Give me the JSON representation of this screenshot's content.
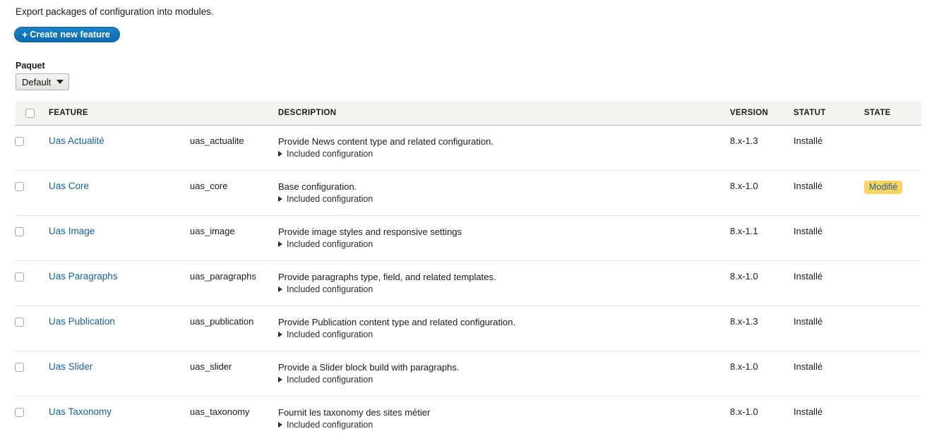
{
  "intro": {
    "text": "Export packages of configuration into modules."
  },
  "actions": {
    "create_feature": {
      "plus": "+",
      "label": "Create new feature"
    }
  },
  "filter": {
    "label": "Paquet",
    "selected": "Default",
    "options": [
      "Default"
    ],
    "caret_icon": "chevron-down-icon"
  },
  "table": {
    "select_all_name": "select-all-checkbox",
    "columns": [
      {
        "key": "check",
        "label": ""
      },
      {
        "key": "feature",
        "label": "FEATURE"
      },
      {
        "key": "machine",
        "label": ""
      },
      {
        "key": "description",
        "label": "DESCRIPTION"
      },
      {
        "key": "version",
        "label": "VERSION"
      },
      {
        "key": "statut",
        "label": "STATUT"
      },
      {
        "key": "state",
        "label": "STATE"
      }
    ],
    "details_label": "Included configuration",
    "rows": [
      {
        "feature": "Uas Actualité",
        "machine": "uas_actualite",
        "description": "Provide News content type and related configuration.",
        "details": "Included configuration",
        "version": "8.x-1.3",
        "statut": "Installé",
        "state": ""
      },
      {
        "feature": "Uas Core",
        "machine": "uas_core",
        "description": "Base configuration.",
        "details": "Included configuration",
        "version": "8.x-1.0",
        "statut": "Installé",
        "state": "Modifié"
      },
      {
        "feature": "Uas Image",
        "machine": "uas_image",
        "description": "Provide image styles and responsive settings",
        "details": "Included configuration",
        "version": "8.x-1.1",
        "statut": "Installé",
        "state": ""
      },
      {
        "feature": "Uas Paragraphs",
        "machine": "uas_paragraphs",
        "description": "Provide paragraphs type, field, and related templates.",
        "details": "Included configuration",
        "version": "8.x-1.0",
        "statut": "Installé",
        "state": ""
      },
      {
        "feature": "Uas Publication",
        "machine": "uas_publication",
        "description": "Provide Publication content type and related configuration.",
        "details": "Included configuration",
        "version": "8.x-1.3",
        "statut": "Installé",
        "state": ""
      },
      {
        "feature": "Uas Slider",
        "machine": "uas_slider",
        "description": "Provide a Slider block build with paragraphs.",
        "details": "Included configuration",
        "version": "8.x-1.0",
        "statut": "Installé",
        "state": ""
      },
      {
        "feature": "Uas Taxonomy",
        "machine": "uas_taxonomy",
        "description": "Fournit les taxonomy des sites métier",
        "details": "Included configuration",
        "version": "8.x-1.0",
        "statut": "Installé",
        "state": ""
      }
    ]
  },
  "colors": {
    "accent_button": "#0f76bc",
    "link": "#17609e",
    "badge_bg": "#fbd45c",
    "badge_text": "#1a5f9e",
    "header_bg": "#f3f3ef"
  }
}
